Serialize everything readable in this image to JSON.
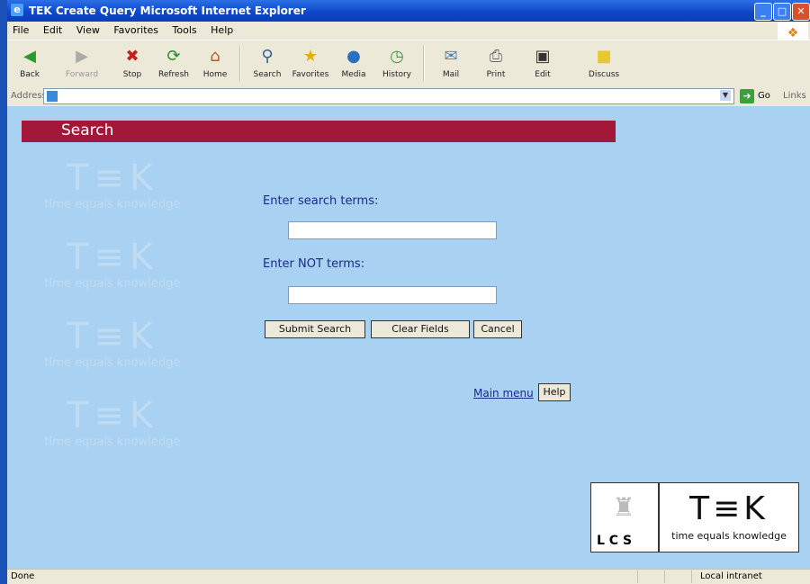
{
  "window": {
    "title": "TEK  Create Query  Microsoft Internet Explorer",
    "min_label": "_",
    "max_label": "□",
    "close_label": "✕"
  },
  "menu": [
    "File",
    "Edit",
    "View",
    "Favorites",
    "Tools",
    "Help"
  ],
  "toolbar": {
    "back": "Back",
    "forward": "Forward",
    "stop": "Stop",
    "refresh": "Refresh",
    "home": "Home",
    "search": "Search",
    "favorites": "Favorites",
    "media": "Media",
    "history": "History",
    "mail": "Mail",
    "print": "Print",
    "edit": "Edit",
    "discuss": "Discuss"
  },
  "address": {
    "label": "Address",
    "url": "",
    "go_label": "Go",
    "links_label": "Links"
  },
  "page": {
    "banner": "Search",
    "watermark": {
      "big": "T≡K",
      "small": "time equals knowledge"
    },
    "search_terms_label": "Enter search terms:",
    "search_terms_value": "",
    "not_terms_label": "Enter NOT terms:",
    "not_terms_value": "",
    "buttons": {
      "submit": "Submit Search",
      "clear": "Clear Fields",
      "cancel": "Cancel"
    },
    "main_menu_link": "Main menu",
    "help_button": "Help",
    "logo_lcs": "L C S",
    "logo_tek": {
      "big": "T≡K",
      "small": "time equals knowledge"
    }
  },
  "status": {
    "left": "Done",
    "zone": "Local intranet"
  },
  "colors": {
    "banner": "#a31838",
    "background": "#a9d2f2",
    "label_text": "#1a2a8a"
  }
}
